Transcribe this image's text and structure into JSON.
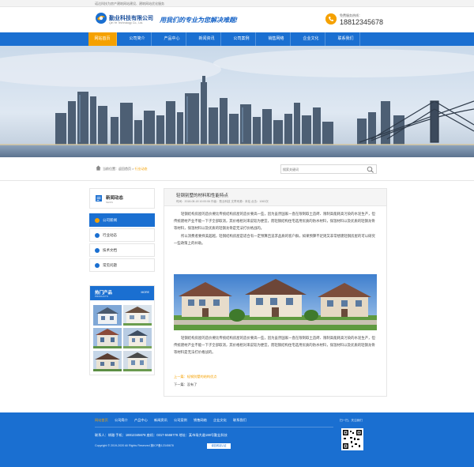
{
  "top_bar": {
    "text": "诺达科技为房产建筑网站建设、建筑网站优化服务"
  },
  "header": {
    "company_name": "勤业科技有限公司",
    "company_name_en": "Qin Ye Technology Co., Ltd.",
    "slogan": "用我们的专业为您解决难题!",
    "phone_label": "免费服务热线：",
    "phone": "18812345678"
  },
  "nav": {
    "items": [
      {
        "label": "网站首页",
        "active": true
      },
      {
        "label": "公司简介"
      },
      {
        "label": "产品中心"
      },
      {
        "label": "新闻资讯"
      },
      {
        "label": "公司案例"
      },
      {
        "label": "销售网络"
      },
      {
        "label": "企业文化"
      },
      {
        "label": "联系我们"
      }
    ]
  },
  "breadcrumb": {
    "prefix": "当前位置：",
    "home": "返回首页",
    "sep": " > ",
    "current": "行业动态"
  },
  "search": {
    "placeholder": "搜索关键词"
  },
  "sidebar": {
    "title": "新闻动态",
    "title_en": "NEWS",
    "items": [
      {
        "label": "公司新闻",
        "active": true
      },
      {
        "label": "行业动态"
      },
      {
        "label": "技术文档"
      },
      {
        "label": "常见问题"
      }
    ]
  },
  "hot_products": {
    "title": "热门产品",
    "title_en": "PRODUCTS",
    "more": "MORE"
  },
  "article": {
    "title": "轻钢别墅的材料和性能特点",
    "meta": "时间：2018-08-18 10:00:06   作者：勤业科技   文章来源：本站   点击：1063次",
    "para1": "轻钢结构房屋的造价要比传统结构房屋的造价要高一些，因为虽然国家一直在限制取土造砖、限制高能耗高污染的水泥生产，但传统建材产业不能一下子全部取消，其价格相对来说较为便宜，而轻钢结构住宅选用优质的防水材料，保温材料以及优质的轻钢龙骨等材料，保温材料以及优质的轻钢龙骨是无法打价格战的。",
    "para2": "所以消费者要择美超越，轻钢结构房屋是适合有一定预算且追求品质的客户群，如果预算不足则又非常想建轻钢房屋的可以研究一些政策上的补助。",
    "para3": "轻钢结构房屋的造价要比传统结构房屋的造价要高一些，因为虽然国家一直在限制取土造砖、限制高能耗高污染的水泥生产，但传统建材产业不能一下子全部取消，其价格相对来说较为便宜，而轻钢结构住宅选用优质的防水材料，保温材料以及优质的轻钢龙骨等材料是无法打价格战的。",
    "prev_label": "上一篇：",
    "prev_title": "轻钢别墅的结构优点",
    "next_label": "下一篇：",
    "next_title": "没有了"
  },
  "footer": {
    "nav": [
      {
        "label": "网站首页",
        "active": true
      },
      {
        "label": "公司简介"
      },
      {
        "label": "产品中心"
      },
      {
        "label": "新闻资讯"
      },
      {
        "label": "公司案例"
      },
      {
        "label": "销售网络"
      },
      {
        "label": "企业文化"
      },
      {
        "label": "联系我们"
      }
    ],
    "contact": "联系人：胡雅     手机：18812345678     座机：0317-5566778     地址：某市场大道188号勤业科技",
    "copyright": "Copyright © 2019-2020 All Rights Reserved 冀ICP备12345678",
    "badge": "诚信网站认证",
    "qr_label": "扫一扫，关注我们"
  },
  "colors": {
    "primary": "#1a6fd1",
    "accent": "#f5a100"
  }
}
